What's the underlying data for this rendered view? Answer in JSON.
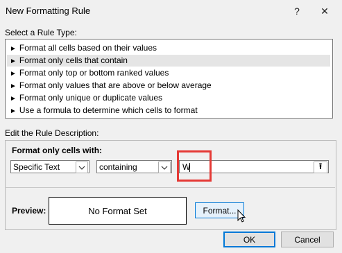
{
  "window": {
    "title": "New Formatting Rule",
    "help_glyph": "?",
    "close_glyph": "✕"
  },
  "rule_type": {
    "heading": "Select a Rule Type:",
    "items": [
      {
        "label": "Format all cells based on their values",
        "selected": false
      },
      {
        "label": "Format only cells that contain",
        "selected": true
      },
      {
        "label": "Format only top or bottom ranked values",
        "selected": false
      },
      {
        "label": "Format only values that are above or below average",
        "selected": false
      },
      {
        "label": "Format only unique or duplicate values",
        "selected": false
      },
      {
        "label": "Use a formula to determine which cells to format",
        "selected": false
      }
    ],
    "item_glyph": "►"
  },
  "description": {
    "heading": "Edit the Rule Description:",
    "subheading": "Format only cells with:",
    "condition_type": "Specific Text",
    "operator": "containing",
    "value": "W",
    "collapse_glyph": "⭱"
  },
  "preview": {
    "label": "Preview:",
    "text": "No Format Set"
  },
  "buttons": {
    "format": "Format...",
    "ok": "OK",
    "cancel": "Cancel"
  },
  "colors": {
    "highlight": "#e53935",
    "accent": "#0078d7"
  }
}
